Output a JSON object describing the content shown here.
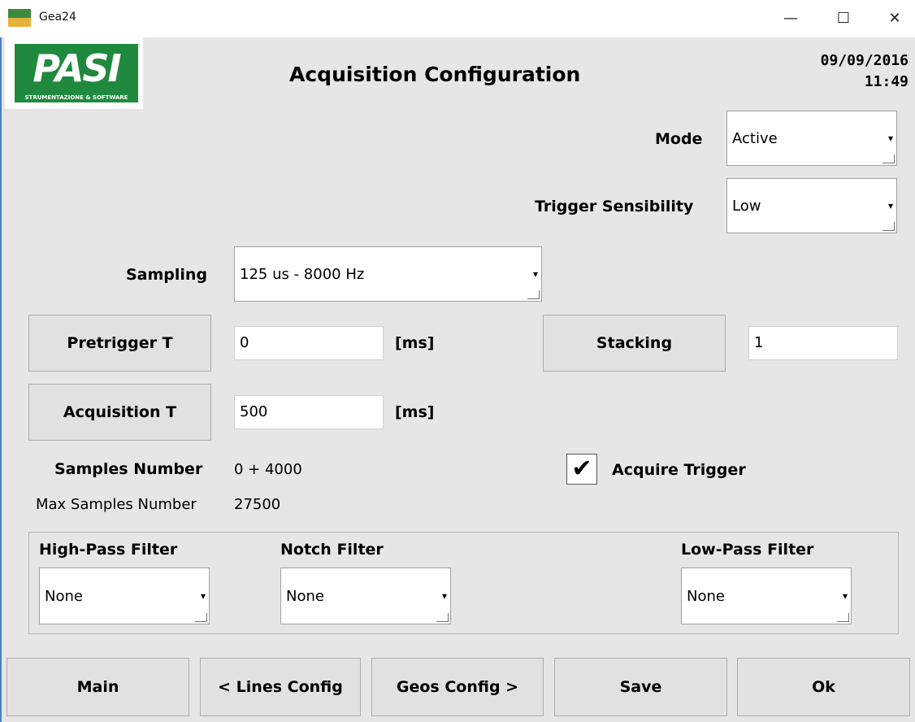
{
  "window": {
    "title": "Gea24",
    "minimize": "—",
    "maximize": "☐",
    "close": "✕"
  },
  "logo": {
    "main": "PASI",
    "sub": "STRUMENTAZIONE & SOFTWARE"
  },
  "header": {
    "title": "Acquisition Configuration",
    "date": "09/09/2016",
    "time": "11:49"
  },
  "mode": {
    "label": "Mode",
    "value": "Active"
  },
  "trigger_sensibility": {
    "label": "Trigger Sensibility",
    "value": "Low"
  },
  "sampling": {
    "label": "Sampling",
    "value": "125 us - 8000 Hz"
  },
  "pretrigger": {
    "button": "Pretrigger T",
    "value": "0",
    "unit": "[ms]"
  },
  "stacking": {
    "button": "Stacking",
    "value": "1"
  },
  "acquisition": {
    "button": "Acquisition T",
    "value": "500",
    "unit": "[ms]"
  },
  "samples": {
    "label": "Samples Number",
    "value": "0 + 4000"
  },
  "max_samples": {
    "label": "Max Samples Number",
    "value": "27500"
  },
  "acquire_trigger": {
    "label": "Acquire Trigger",
    "checked": true,
    "check_glyph": "✔"
  },
  "filters": {
    "high_pass": {
      "label": "High-Pass Filter",
      "value": "None"
    },
    "notch": {
      "label": "Notch Filter",
      "value": "None"
    },
    "low_pass": {
      "label": "Low-Pass Filter",
      "value": "None"
    }
  },
  "footer": {
    "main": "Main",
    "lines": "< Lines Config",
    "geos": "Geos Config >",
    "save": "Save",
    "ok": "Ok"
  },
  "icons": {
    "dropdown_arrow": "▾"
  },
  "colors": {
    "background": "#e6e6e6",
    "logo_green": "#1f8a3d"
  }
}
